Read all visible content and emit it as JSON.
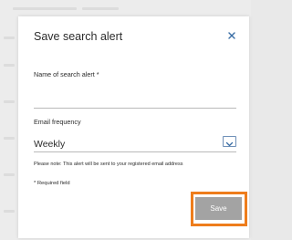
{
  "dialog": {
    "title": "Save search alert",
    "close_icon": "close-icon"
  },
  "name_field": {
    "label": "Name of search alert *",
    "value": "",
    "placeholder": ""
  },
  "frequency_field": {
    "label": "Email frequency",
    "selected": "Weekly",
    "chevron_icon": "chevron-down-icon"
  },
  "note": "Please note: This alert will be sent to your registered email address",
  "required_note": "* Required field",
  "save_button": {
    "label": "Save"
  },
  "colors": {
    "highlight": "#ee7d1c",
    "save_bg": "#a3a3a3",
    "close_icon": "#3a6ea5",
    "chevron": "#3a6ea5"
  }
}
